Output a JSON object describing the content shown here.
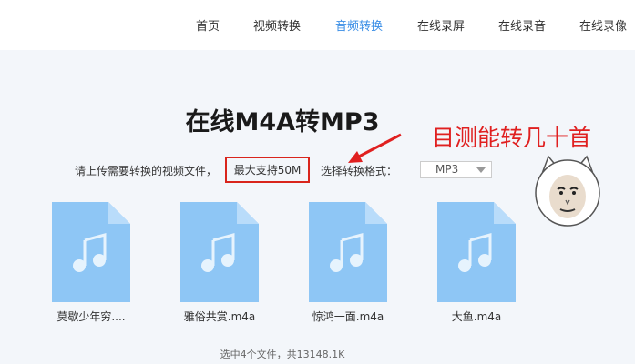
{
  "nav": {
    "items": [
      {
        "label": "首页",
        "active": false
      },
      {
        "label": "视频转换",
        "active": false
      },
      {
        "label": "音频转换",
        "active": true
      },
      {
        "label": "在线录屏",
        "active": false
      },
      {
        "label": "在线录音",
        "active": false
      },
      {
        "label": "在线录像",
        "active": false
      }
    ]
  },
  "main": {
    "title": "在线M4A转MP3",
    "hint": "请上传需要转换的视频文件，",
    "size_limit": "最大支持50M",
    "format_label": "选择转换格式：",
    "format_value": "MP3",
    "annotation": "目测能转几十首"
  },
  "files": [
    {
      "name": "莫歇少年穷...."
    },
    {
      "name": "雅俗共赏.m4a"
    },
    {
      "name": "惊鸿一面.m4a"
    },
    {
      "name": "大鱼.m4a"
    }
  ],
  "summary": "选中4个文件，共13148.1K",
  "colors": {
    "accent": "#3a8ee6",
    "annotation_red": "#e02020",
    "file_icon": "#8ec6f5",
    "file_icon_fold": "#b9dcfa"
  },
  "icons": {
    "file": "music-file-icon",
    "arrow": "red-arrow",
    "meme": "meme-face"
  }
}
